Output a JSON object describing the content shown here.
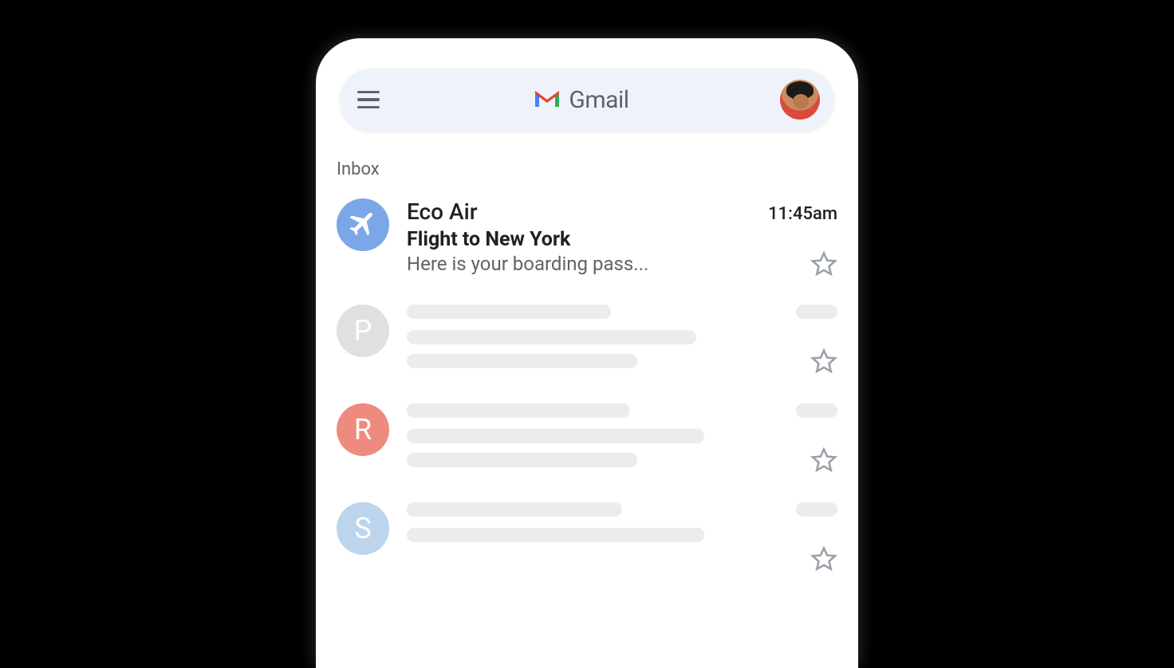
{
  "header": {
    "brand_label": "Gmail"
  },
  "inbox": {
    "section_label": "Inbox",
    "emails": [
      {
        "sender": "Eco Air",
        "subject": "Flight to New York",
        "snippet": "Here is your boarding pass...",
        "time": "11:45am",
        "avatar_icon": "airplane",
        "avatar_color": "#7ba7e8",
        "starred": false
      }
    ],
    "placeholder_avatars": [
      "P",
      "R",
      "S"
    ]
  }
}
